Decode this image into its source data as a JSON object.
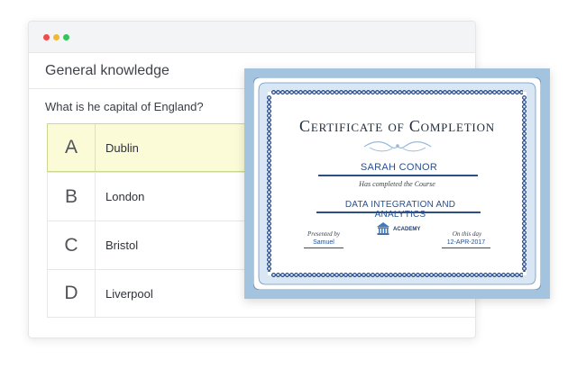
{
  "window": {
    "controls": [
      {
        "name": "close",
        "color": "#ee4d4d"
      },
      {
        "name": "minimize",
        "color": "#f5b72f"
      },
      {
        "name": "maximize",
        "color": "#36c45a"
      }
    ]
  },
  "quiz": {
    "title": "General knowledge",
    "question": "What is he capital of England?",
    "answers": [
      {
        "letter": "A",
        "text": "Dublin",
        "selected": true
      },
      {
        "letter": "B",
        "text": "London",
        "selected": false
      },
      {
        "letter": "C",
        "text": "Bristol",
        "selected": false
      },
      {
        "letter": "D",
        "text": "Liverpool",
        "selected": false
      }
    ]
  },
  "certificate": {
    "heading": "Certificate of Completion",
    "recipient": "SARAH CONOR",
    "subtitle": "Has completed the Course",
    "course": "DATA INTEGRATION AND ANALYTICS",
    "presented_label": "Presented by",
    "presented_by": "Samuel",
    "date_label": "On this day",
    "date": "12-APR-2017",
    "academy": "ACADEMY",
    "colors": {
      "frame": "#a4c3df",
      "accent": "#28508f"
    }
  }
}
